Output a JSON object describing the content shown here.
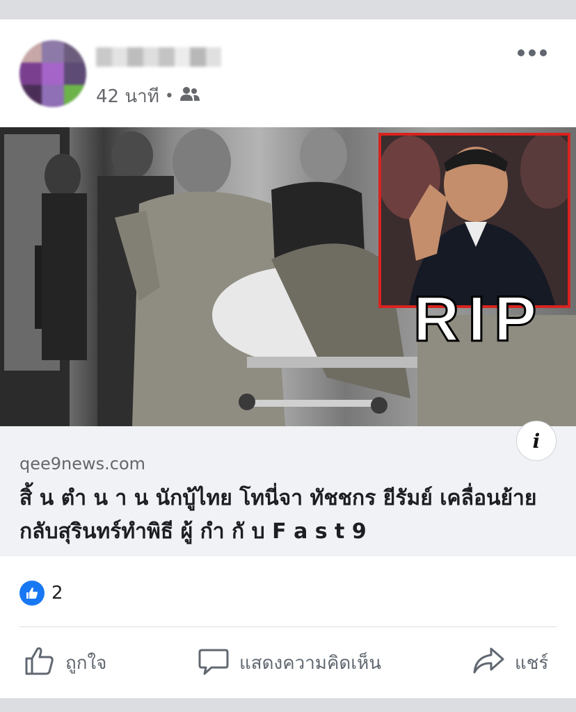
{
  "post": {
    "time": "42 นาที",
    "separator": "•"
  },
  "icons": {
    "audience": "friends-icon",
    "more": "more-options-icon",
    "info": "info-icon",
    "like": "thumbs-up-icon",
    "comment": "comment-icon",
    "share": "share-icon"
  },
  "image": {
    "overlay_text": "RIP"
  },
  "link": {
    "domain": "qee9news.com",
    "title": "สิ้ น ตำ น า น นักบู้ไทย โทนี่จา ทัชชกร ยีรัมย์ เคลื่อนย้ายกลับสุรินทร์ทำพิธี ผู้ กำ กั บ F a s t 9",
    "info_label": "i"
  },
  "reactions": {
    "count": "2"
  },
  "actions": {
    "like": "ถูกใจ",
    "comment": "แสดงความคิดเห็น",
    "share": "แชร์"
  },
  "colors": {
    "accent": "#1877f2",
    "rip_frame": "#d8231f",
    "link_bg": "#f0f2f5"
  }
}
